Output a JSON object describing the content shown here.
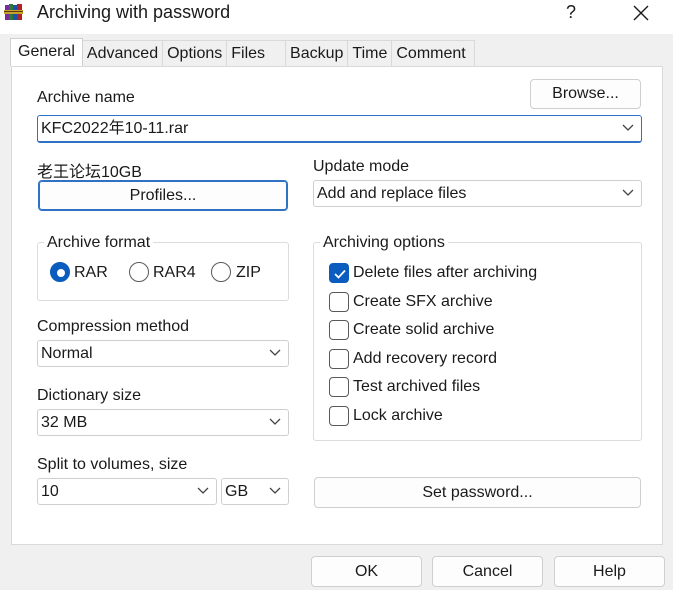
{
  "window": {
    "title": "Archiving with password",
    "help_glyph": "?",
    "close_glyph": "✕"
  },
  "tabs": [
    {
      "label": "General",
      "active": true
    },
    {
      "label": "Advanced"
    },
    {
      "label": "Options"
    },
    {
      "label": "Files"
    },
    {
      "label": "Backup"
    },
    {
      "label": "Time"
    },
    {
      "label": "Comment"
    }
  ],
  "general": {
    "archive_name_label": "Archive name",
    "browse_label": "Browse...",
    "archive_name_value": "KFC2022年10-11.rar",
    "profile_name": "老王论坛10GB",
    "profiles_label": "Profiles...",
    "update_mode_label": "Update mode",
    "update_mode_value": "Add and replace files",
    "archive_format_label": "Archive format",
    "formats": [
      {
        "label": "RAR",
        "checked": true
      },
      {
        "label": "RAR4",
        "checked": false
      },
      {
        "label": "ZIP",
        "checked": false
      }
    ],
    "compression_method_label": "Compression method",
    "compression_method_value": "Normal",
    "dictionary_size_label": "Dictionary size",
    "dictionary_size_value": "32 MB",
    "split_label": "Split to volumes, size",
    "split_value": "10",
    "split_unit": "GB",
    "archiving_options_label": "Archiving options",
    "options": [
      {
        "label": "Delete files after archiving",
        "checked": true
      },
      {
        "label": "Create SFX archive",
        "checked": false
      },
      {
        "label": "Create solid archive",
        "checked": false
      },
      {
        "label": "Add recovery record",
        "checked": false
      },
      {
        "label": "Test archived files",
        "checked": false
      },
      {
        "label": "Lock archive",
        "checked": false
      }
    ],
    "set_password_label": "Set password..."
  },
  "footer": {
    "ok_label": "OK",
    "cancel_label": "Cancel",
    "help_label": "Help"
  },
  "colors": {
    "accent": "#0a5cbf",
    "focus_border": "#2f72c4",
    "panel_bg": "#ffffff",
    "window_bg": "#f0f0f0"
  },
  "icons": {
    "app": "winrar-books-icon",
    "close": "close-icon",
    "chevron": "chevron-down-icon",
    "check": "checkmark-icon"
  }
}
